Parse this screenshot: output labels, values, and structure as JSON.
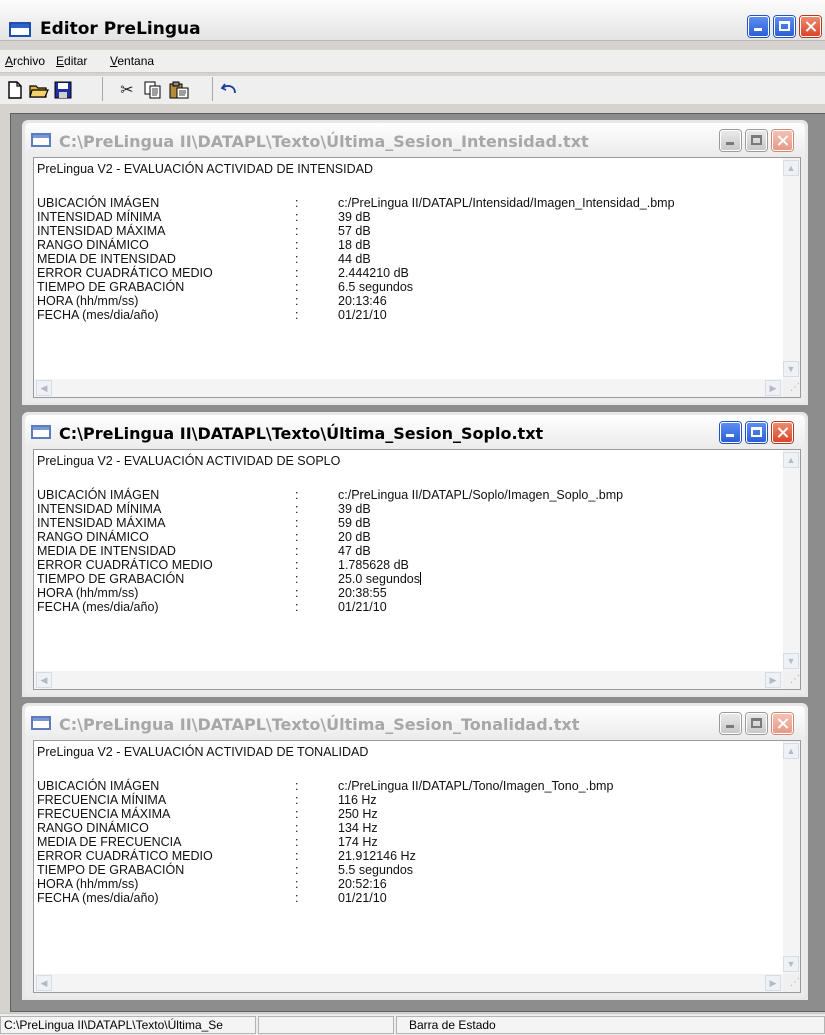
{
  "window": {
    "title": "Editor PreLingua"
  },
  "menu": {
    "items": [
      {
        "first": "A",
        "rest": "rchivo"
      },
      {
        "first": "E",
        "rest": "ditar"
      },
      {
        "first": "V",
        "rest": "entana"
      }
    ]
  },
  "toolbar": {
    "buttons": [
      "new-icon",
      "open-folder-icon",
      "save-icon",
      "cut-icon",
      "copy-icon",
      "paste-icon",
      "undo-icon"
    ]
  },
  "windows": [
    {
      "title": "C:\\PreLingua II\\DATAPL\\Texto\\Última_Sesion_Intensidad.txt",
      "header": "PreLingua V2 - EVALUACIÓN ACTIVIDAD DE INTENSIDAD",
      "rows": [
        {
          "label": "UBICACIÓN IMÁGEN",
          "sep": ":",
          "value": "c:/PreLingua II/DATAPL/Intensidad/Imagen_Intensidad_.bmp"
        },
        {
          "label": "INTENSIDAD MÍNIMA",
          "sep": ":",
          "value": "39 dB"
        },
        {
          "label": "INTENSIDAD MÁXIMA",
          "sep": ":",
          "value": "57 dB"
        },
        {
          "label": "RANGO DINÁMICO",
          "sep": ":",
          "value": "18 dB"
        },
        {
          "label": "MEDIA DE INTENSIDAD",
          "sep": ":",
          "value": "44 dB"
        },
        {
          "label": "ERROR CUADRÁTICO MEDIO",
          "sep": ":",
          "value": "2.444210 dB"
        },
        {
          "label": "TIEMPO DE GRABACIÓN",
          "sep": ":",
          "value": "6.5 segundos"
        },
        {
          "label": "HORA (hh/mm/ss)",
          "sep": ":",
          "value": "20:13:46"
        },
        {
          "label": "FECHA (mes/dia/año)",
          "sep": ":",
          "value": "01/21/10"
        }
      ]
    },
    {
      "title": "C:\\PreLingua II\\DATAPL\\Texto\\Última_Sesion_Soplo.txt",
      "header": "PreLingua V2 - EVALUACIÓN ACTIVIDAD DE SOPLO",
      "rows": [
        {
          "label": "UBICACIÓN IMÁGEN",
          "sep": ":",
          "value": "c:/PreLingua II/DATAPL/Soplo/Imagen_Soplo_.bmp"
        },
        {
          "label": "INTENSIDAD MÍNIMA",
          "sep": ":",
          "value": "39 dB"
        },
        {
          "label": "INTENSIDAD MÁXIMA",
          "sep": ":",
          "value": "59 dB"
        },
        {
          "label": "RANGO DINÁMICO",
          "sep": ":",
          "value": "20 dB"
        },
        {
          "label": "MEDIA DE INTENSIDAD",
          "sep": ":",
          "value": "47 dB"
        },
        {
          "label": "ERROR CUADRÁTICO MEDIO",
          "sep": ":",
          "value": "1.785628 dB"
        },
        {
          "label": "TIEMPO DE GRABACIÓN",
          "sep": ":",
          "value": "25.0 segundos"
        },
        {
          "label": "HORA (hh/mm/ss)",
          "sep": ":",
          "value": "20:38:55"
        },
        {
          "label": "FECHA (mes/dia/año)",
          "sep": ":",
          "value": "01/21/10"
        }
      ]
    },
    {
      "title": "C:\\PreLingua II\\DATAPL\\Texto\\Última_Sesion_Tonalidad.txt",
      "header": "PreLingua V2 - EVALUACIÓN ACTIVIDAD DE TONALIDAD",
      "rows": [
        {
          "label": "UBICACIÓN IMÁGEN",
          "sep": ":",
          "value": "c:/PreLingua II/DATAPL/Tono/Imagen_Tono_.bmp"
        },
        {
          "label": "FRECUENCIA MÍNIMA",
          "sep": ":",
          "value": "116 Hz"
        },
        {
          "label": "FRECUENCIA MÁXIMA",
          "sep": ":",
          "value": "250 Hz"
        },
        {
          "label": "RANGO DINÁMICO",
          "sep": ":",
          "value": "134 Hz"
        },
        {
          "label": "MEDIA DE FRECUENCIA",
          "sep": ":",
          "value": "174 Hz"
        },
        {
          "label": "ERROR CUADRÁTICO MEDIO",
          "sep": ":",
          "value": "21.912146 Hz"
        },
        {
          "label": "TIEMPO DE GRABACIÓN",
          "sep": ":",
          "value": "5.5 segundos"
        },
        {
          "label": "HORA (hh/mm/ss)",
          "sep": ":",
          "value": "20:52:16"
        },
        {
          "label": "FECHA (mes/dia/año)",
          "sep": ":",
          "value": "01/21/10"
        }
      ]
    }
  ],
  "statusbar": {
    "path": "C:\\PreLingua II\\DATAPL\\Texto\\Última_Se",
    "middle": "",
    "status": "Barra de Estado"
  }
}
